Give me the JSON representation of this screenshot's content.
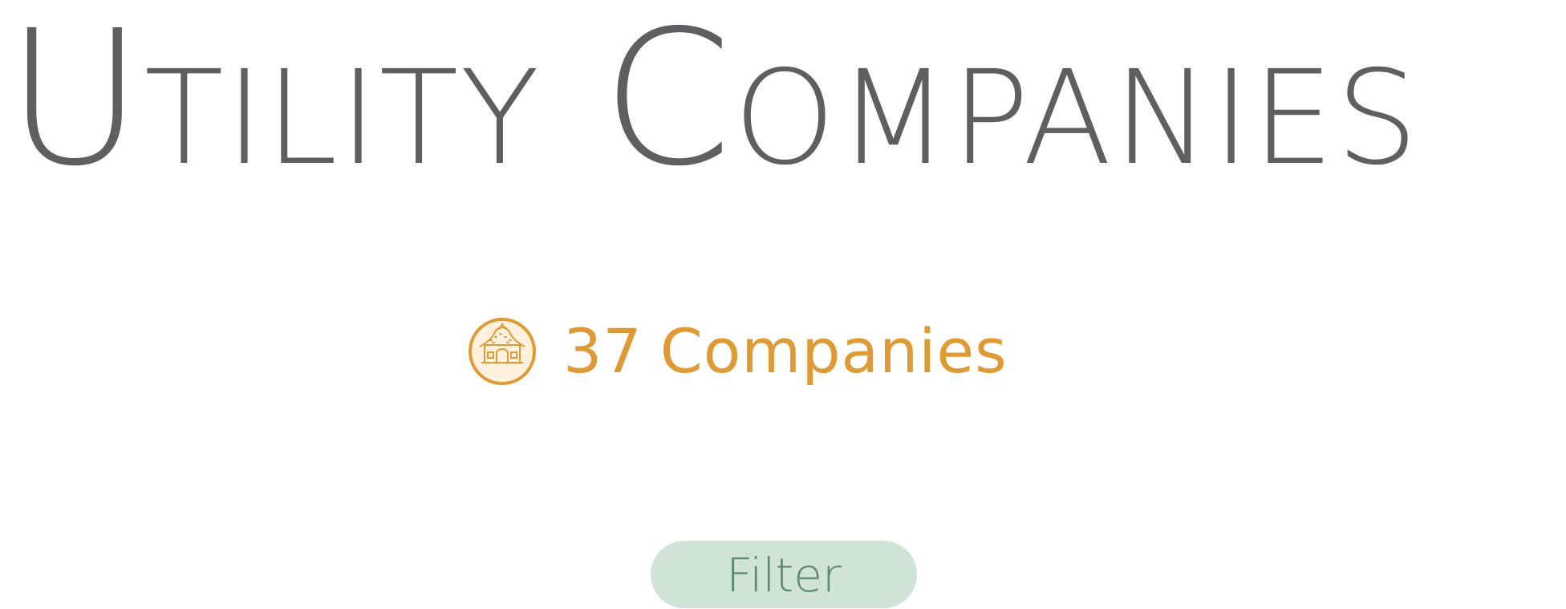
{
  "header": {
    "title": "Utility Companies"
  },
  "summary": {
    "count": "37",
    "label": "Companies",
    "icon": "utility-building-icon"
  },
  "actions": {
    "filter_label": "Filter"
  },
  "colors": {
    "title": "#5f5f62",
    "accent": "#e09a35",
    "filter_background": "#cfe4d6",
    "filter_text": "#5c8a6d"
  }
}
